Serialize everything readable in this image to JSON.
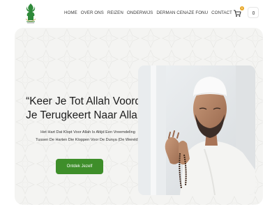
{
  "header": {
    "logo_icon": "crescent-mosque-logo-icon",
    "nav": [
      {
        "label": "HOME"
      },
      {
        "label": "OVER ONS"
      },
      {
        "label": "REIZEN"
      },
      {
        "label": "ONDERWIJS"
      },
      {
        "label": "DERMAN CENAZE FONU"
      },
      {
        "label": "CONTACT"
      }
    ],
    "cart_icon": "shopping-cart-icon",
    "cart_count": "0",
    "user_icon": "user-icon"
  },
  "hero": {
    "headline": [
      "“Keer Je Tot Allah Voordat",
      "Je Terugkeert Naar Allah.”"
    ],
    "subtitle": [
      "Het Hart Dat Klopt Voor Allah Is Altijd Een Vreemdeling",
      "Tussen De Harten Die Kloppen Voor De Dunya (De Wereld)."
    ],
    "cta_label": "Ontdek Jezelf",
    "image": "praying-man-photo"
  },
  "colors": {
    "accent_green": "#3e8e2a",
    "badge_orange": "#e8a623",
    "hero_bg": "#f4f4f2"
  }
}
